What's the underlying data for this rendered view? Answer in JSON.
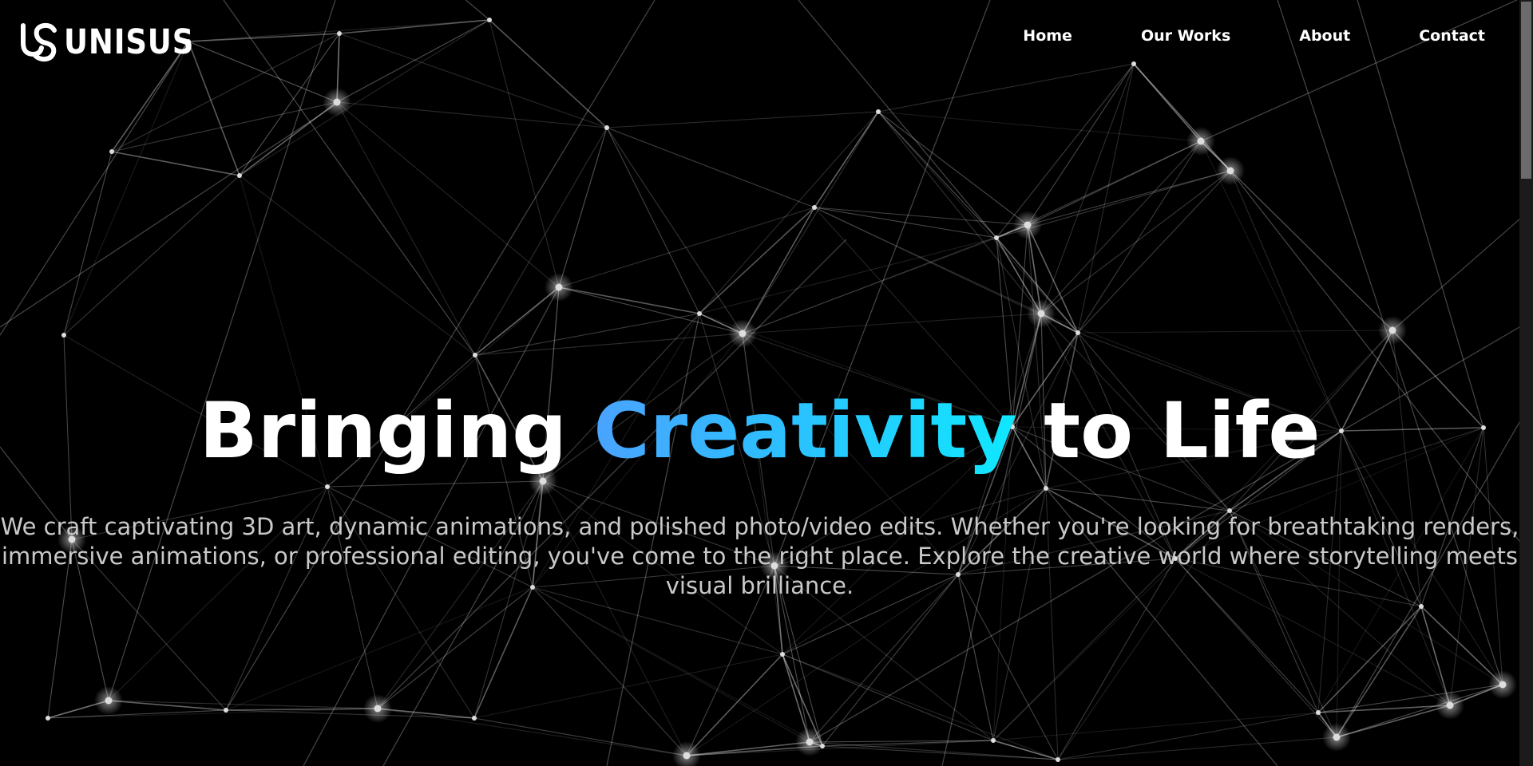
{
  "brand": {
    "name": "UNISUS",
    "logo_icon": "unisus-logo-icon"
  },
  "nav": {
    "items": [
      {
        "label": "Home"
      },
      {
        "label": "Our Works"
      },
      {
        "label": "About"
      },
      {
        "label": "Contact"
      }
    ]
  },
  "hero": {
    "title_before": "Bringing",
    "title_accent": "Creativity",
    "title_after": "to Life",
    "description": "We craft captivating 3D art, dynamic animations, and polished photo/video edits. Whether you're looking for breathtaking renders, immersive animations, or professional editing, you've come to the right place. Explore the creative world where storytelling meets visual brilliance."
  },
  "colors": {
    "background": "#000000",
    "text": "#ffffff",
    "description_text": "#c9c9c9",
    "accent_gradient_start": "#4aa3ff",
    "accent_gradient_end": "#10e8ff",
    "network_lines": "#ffffff"
  }
}
